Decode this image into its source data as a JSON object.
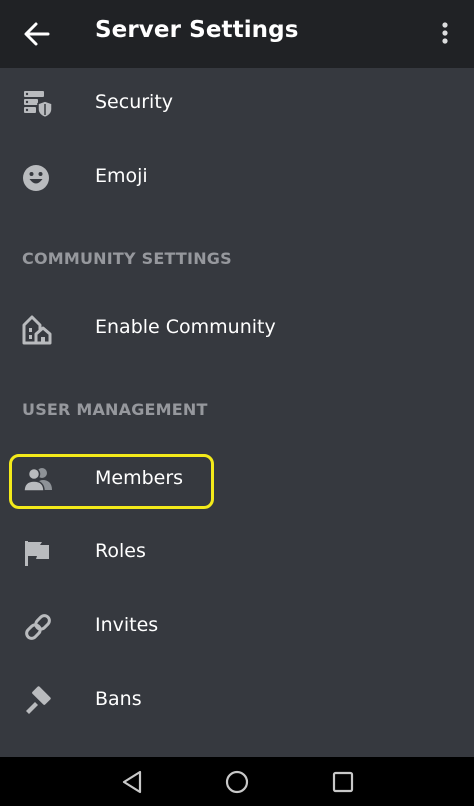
{
  "header": {
    "title": "Server Settings",
    "back_icon": "arrow-left-icon",
    "menu_icon": "more-vertical-icon"
  },
  "items_top": [
    {
      "label": "Security",
      "icon": "shield-list-icon"
    },
    {
      "label": "Emoji",
      "icon": "smiley-icon"
    }
  ],
  "community": {
    "heading": "COMMUNITY SETTINGS",
    "items": [
      {
        "label": "Enable Community",
        "icon": "community-houses-icon"
      }
    ]
  },
  "user_management": {
    "heading": "USER MANAGEMENT",
    "items": [
      {
        "label": "Members",
        "icon": "people-icon",
        "highlighted": true
      },
      {
        "label": "Roles",
        "icon": "flag-icon"
      },
      {
        "label": "Invites",
        "icon": "link-icon"
      },
      {
        "label": "Bans",
        "icon": "hammer-icon"
      }
    ]
  },
  "colors": {
    "background": "#36393f",
    "header": "#202225",
    "highlight": "#f3ea1a",
    "section_heading": "#96989d"
  },
  "system_nav": [
    "back-triangle-icon",
    "home-circle-icon",
    "recents-square-icon"
  ]
}
